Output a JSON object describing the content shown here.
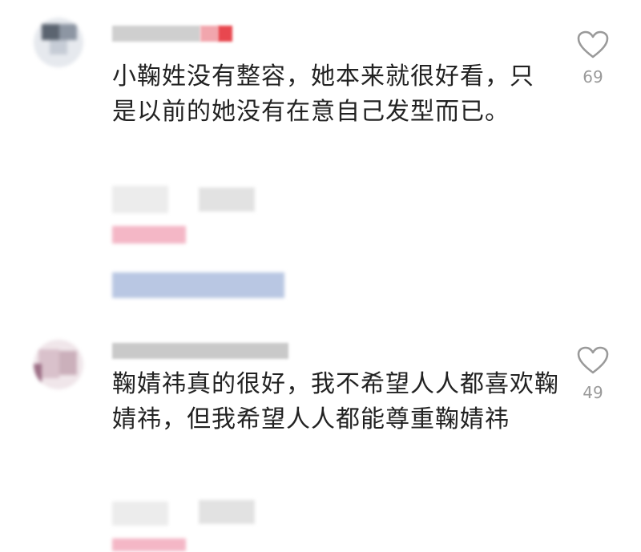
{
  "comments": [
    {
      "text": "小鞠姓没有整容，她本来就很好看，只是以前的她没有在意自己发型而已。",
      "likes": "69",
      "icon": "heart-outline-icon"
    },
    {
      "text": "鞠婧祎真的很好，我不希望人人都喜欢鞠婧祎，但我希望人人都能尊重鞠婧祎",
      "likes": "49",
      "icon": "heart-outline-icon"
    }
  ],
  "colors": {
    "text": "#222222",
    "like_count": "#9a9a9a",
    "heart": "#9a9a9a",
    "pink_tag": "#f4b7c6",
    "blue_blur": "#b9c7e3"
  }
}
